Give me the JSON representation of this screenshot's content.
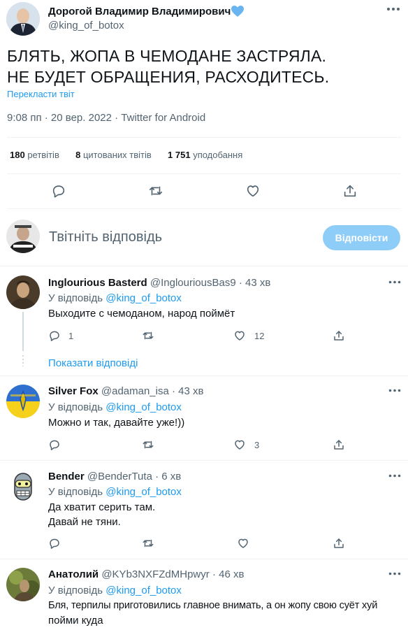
{
  "main_tweet": {
    "author_name": "Дорогой Владимир Владимирович",
    "handle": "@king_of_botox",
    "text_line1": "БЛЯТЬ, ЖОПА В ЧЕМОДАНЕ ЗАСТРЯЛА.",
    "text_line2": "НЕ БУДЕТ ОБРАЩЕНИЯ, РАСХОДИТЕСЬ.",
    "translate": "Перекласти твіт",
    "timestamp": "9:08 пп · 20 вер. 2022 · Twitter for Android",
    "stats": {
      "retweets_count": "180",
      "retweets_label": "ретвітів",
      "quotes_count": "8",
      "quotes_label": "цитованих твітів",
      "likes_count": "1 751",
      "likes_label": "уподобання"
    }
  },
  "composer": {
    "placeholder": "Твітніть відповідь",
    "reply_button": "Відповісти"
  },
  "replies": [
    {
      "name": "Inglourious Basterd",
      "handle": "@InglouriousBas9",
      "time": "· 43 хв",
      "reply_prefix": "У відповідь",
      "reply_to": "@king_of_botox",
      "text": "Выходите с чемоданом, народ поймёт",
      "reply_count": "1",
      "like_count": "12",
      "show_replies": "Показати відповіді"
    },
    {
      "name": "Silver Fox",
      "handle": "@adaman_isa",
      "time": "· 43 хв",
      "reply_prefix": "У відповідь",
      "reply_to": "@king_of_botox",
      "text": "Можно и так, давайте уже!))",
      "like_count": "3"
    },
    {
      "name": "Bender",
      "handle": "@BenderTuta",
      "time": "· 6 хв",
      "reply_prefix": "У відповідь",
      "reply_to": "@king_of_botox",
      "text_line1": "Да хватит серить там.",
      "text_line2": "Давай не тяни."
    },
    {
      "name": "Анатолий",
      "handle": "@KYb3NXFZdMHpwyr",
      "time": "· 46 хв",
      "reply_prefix": "У відповідь",
      "reply_to": "@king_of_botox",
      "text_line1": "Бля, терпилы приготовились главное внимать, а он жопу свою суёт хуй",
      "text_line2": "пойми куда"
    }
  ],
  "colors": {
    "accent": "#1d9bf0",
    "reply_button_disabled": "#8ecdf8",
    "text": "#0f1419",
    "secondary": "#536471"
  }
}
